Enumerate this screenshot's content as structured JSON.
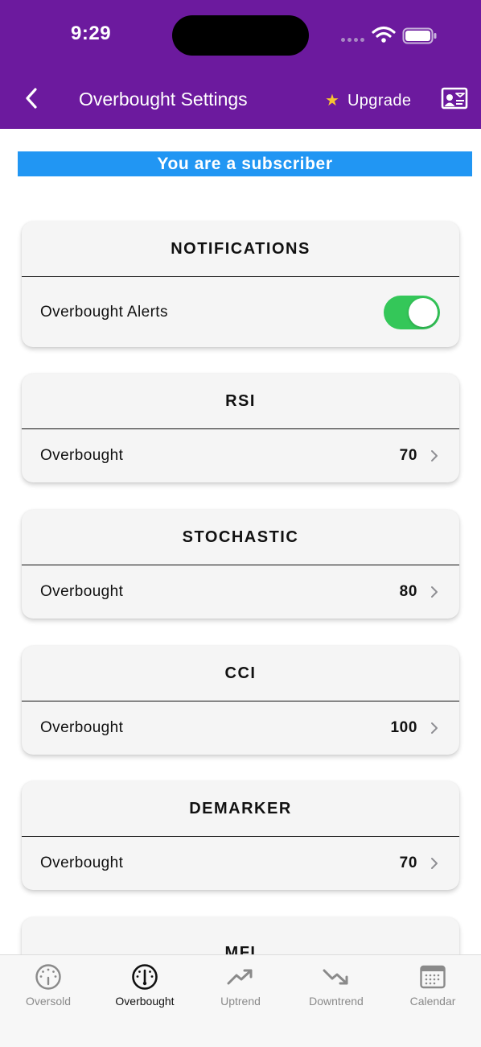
{
  "status_bar": {
    "time": "9:29"
  },
  "header": {
    "title": "Overbought Settings",
    "upgrade_label": "Upgrade",
    "back_icon": "chevron-left-icon",
    "profile_icon": "id-card-icon"
  },
  "banner": {
    "text": "You are a subscriber"
  },
  "notifications": {
    "title": "NOTIFICATIONS",
    "alerts_label": "Overbought Alerts",
    "alerts_enabled": true
  },
  "indicators": [
    {
      "title": "RSI",
      "row_label": "Overbought",
      "value": "70"
    },
    {
      "title": "STOCHASTIC",
      "row_label": "Overbought",
      "value": "80"
    },
    {
      "title": "CCI",
      "row_label": "Overbought",
      "value": "100"
    },
    {
      "title": "DEMARKER",
      "row_label": "Overbought",
      "value": "70"
    },
    {
      "title": "MFI"
    }
  ],
  "tabs": [
    {
      "label": "Oversold",
      "icon": "gauge-low-icon",
      "active": false
    },
    {
      "label": "Overbought",
      "icon": "gauge-high-icon",
      "active": true
    },
    {
      "label": "Uptrend",
      "icon": "trend-up-icon",
      "active": false
    },
    {
      "label": "Downtrend",
      "icon": "trend-down-icon",
      "active": false
    },
    {
      "label": "Calendar",
      "icon": "calendar-icon",
      "active": false
    }
  ],
  "colors": {
    "header_bg": "#6c1a9e",
    "banner_bg": "#2196f3",
    "toggle_on": "#34c759",
    "star": "#f7c531"
  }
}
